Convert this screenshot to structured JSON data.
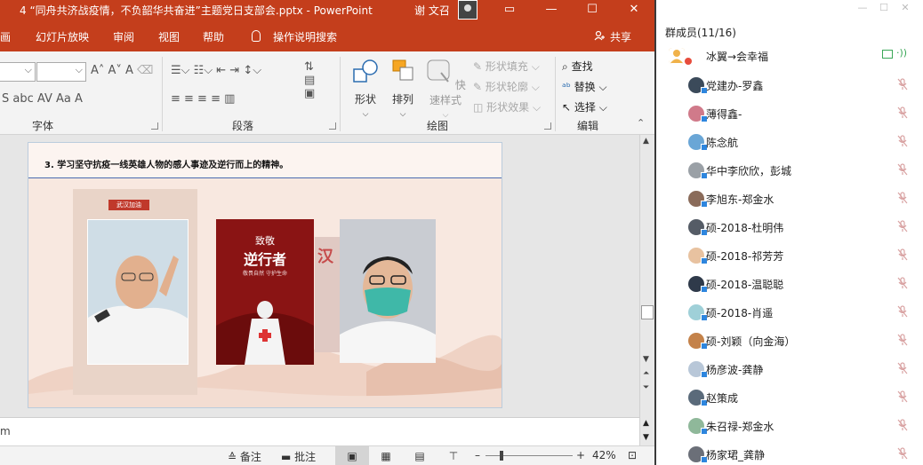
{
  "ppt": {
    "window_title": "4 “同舟共济战疫情，不负韶华共奋进”主题党日支部会.pptx  -  PowerPoint",
    "user_name": "谢 文召",
    "window_buttons": {
      "ribbon": "▭",
      "minimize": "—",
      "maximize": "☐",
      "close": "✕"
    },
    "menu_tabs": [
      "画",
      "幻灯片放映",
      "审阅",
      "视图",
      "帮助",
      "操作说明搜索"
    ],
    "share_label": "共享",
    "ribbon": {
      "font_group_label": "字体",
      "paragraph_group_label": "段落",
      "drawing_group_label": "绘图",
      "editing_group_label": "编辑",
      "font_buttons_row1": "A˄  A˅  A",
      "font_buttons_row2": "S  abc  AV  Aa  A",
      "shape_button": "形状",
      "arrange_button": "排列",
      "quick_styles_button": "快速样式",
      "shape_fill": "形状填充",
      "shape_outline": "形状轮廓",
      "shape_effects": "形状效果",
      "find": "查找",
      "replace": "替换",
      "select": "选择"
    },
    "slide": {
      "heading": "3. 学习坚守抗疫一线英雄人物的感人事迹及逆行而上的精神。",
      "photo1_tag": "武汉加油",
      "photo2_line1": "致敬",
      "photo2_line2": "逆行者",
      "photo2_line3": "敬畏自然 守护生命",
      "photo3_text": "汉"
    },
    "notes_text": "m",
    "status": {
      "notes_label": "备注",
      "comments_label": "批注",
      "zoom_minus": "–",
      "zoom_plus": "+",
      "zoom_level": "42%"
    }
  },
  "panel": {
    "title": "群成员(11/16)",
    "window_buttons": [
      "—",
      "☐",
      "✕"
    ],
    "host": {
      "name": "冰翼→会幸福"
    },
    "members": [
      {
        "name": "党建办-罗鑫",
        "avatar_color": "#3b4a5a"
      },
      {
        "name": "薄得鑫-",
        "avatar_color": "#d07a8a"
      },
      {
        "name": "陈念航",
        "avatar_color": "#6aa6d6"
      },
      {
        "name": "华中李欣欣，彭城",
        "avatar_color": "#9aa0a6"
      },
      {
        "name": "李旭东-郑金水",
        "avatar_color": "#8a6b5a"
      },
      {
        "name": "硕-2018-杜明伟",
        "avatar_color": "#555c66"
      },
      {
        "name": "硕-2018-祁芳芳",
        "avatar_color": "#e8c2a0"
      },
      {
        "name": "硕-2018-温聪聪",
        "avatar_color": "#2f3a4a"
      },
      {
        "name": "硕-2018-肖遥",
        "avatar_color": "#9fd0d8"
      },
      {
        "name": "硕-刘颖（向金海）",
        "avatar_color": "#c4824a"
      },
      {
        "name": "杨彦波-龚静",
        "avatar_color": "#b8c7d8"
      },
      {
        "name": "赵策成",
        "avatar_color": "#5a6a7a"
      },
      {
        "name": "朱召禄-郑金水",
        "avatar_color": "#8fb89a"
      },
      {
        "name": "杨家珺_龚静",
        "avatar_color": "#6b6f78"
      }
    ]
  }
}
